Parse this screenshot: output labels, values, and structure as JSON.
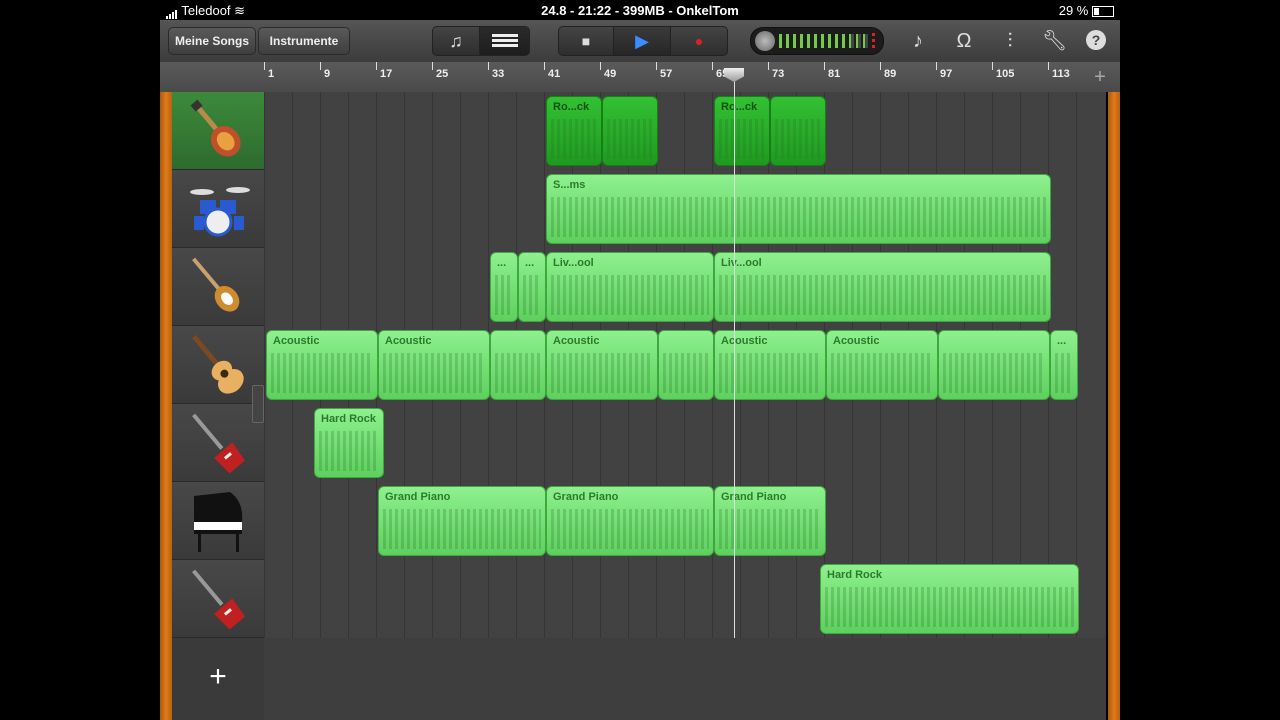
{
  "status": {
    "carrier": "Teledoof",
    "center": "24.8 - 21:22 - 399MB - OnkelTom",
    "battery": "29 %"
  },
  "toolbar": {
    "my_songs": "Meine Songs",
    "instruments": "Instrumente",
    "stop": "■",
    "play": "▶",
    "record": "●"
  },
  "ruler": {
    "bars": [
      "1",
      "9",
      "17",
      "25",
      "33",
      "41",
      "49",
      "57",
      "65",
      "73",
      "81",
      "89",
      "97",
      "105",
      "113"
    ],
    "add": "+"
  },
  "tracks": [
    {
      "name": "Electric guitar (selected)",
      "icon": "electric-guitar-icon"
    },
    {
      "name": "Drums",
      "icon": "drum-kit-icon"
    },
    {
      "name": "Bass",
      "icon": "bass-guitar-icon"
    },
    {
      "name": "Acoustic guitar",
      "icon": "acoustic-guitar-icon"
    },
    {
      "name": "Red guitar",
      "icon": "electric-guitar-red-icon"
    },
    {
      "name": "Grand piano",
      "icon": "grand-piano-icon"
    },
    {
      "name": "Red guitar 2",
      "icon": "electric-guitar-red-icon"
    }
  ],
  "regions": {
    "r0a": "Ro...ck",
    "r0b": "",
    "r0c": "Ro...ck",
    "r0d": "",
    "r1a": "S...ms",
    "r2a": "...",
    "r2b": "...",
    "r2c": "Liv...ool",
    "r2d": "Liv...ool",
    "r3a": "Acoustic",
    "r3b": "Acoustic",
    "r3c": "Acoustic",
    "r3d": "Acoustic",
    "r3e": "Acoustic",
    "r3f": "...",
    "r4a": "Hard Rock",
    "r5a": "Grand Piano",
    "r5b": "Grand Piano",
    "r5c": "Grand Piano",
    "r6a": "Hard Rock"
  },
  "add_track": "+"
}
